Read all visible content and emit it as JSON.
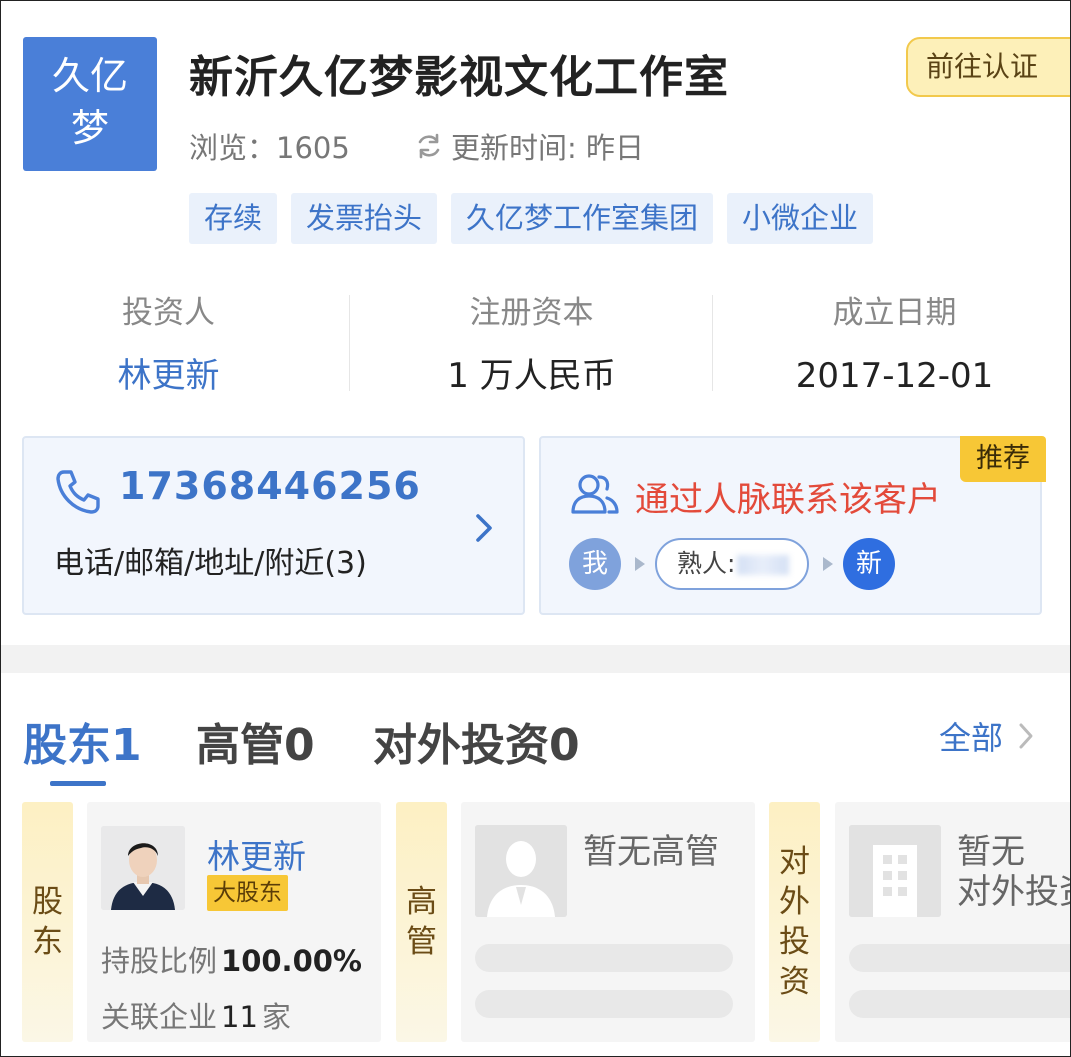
{
  "header": {
    "logo_line1": "久亿",
    "logo_line2": "梦",
    "title": "新沂久亿梦影视文化工作室",
    "verify_button": "前往认证",
    "views_label": "浏览：",
    "views_count": "1605",
    "update_label": "更新时间: 昨日",
    "tags": [
      "存续",
      "发票抬头",
      "久亿梦工作室集团",
      "小微企业"
    ]
  },
  "stats": {
    "investor_label": "投资人",
    "investor_value": "林更新",
    "capital_label": "注册资本",
    "capital_value": "1 万人民币",
    "founded_label": "成立日期",
    "founded_value": "2017-12-01"
  },
  "contact": {
    "phone": "17368446256",
    "sub": "电话/邮箱/地址/附近(3)"
  },
  "network": {
    "badge": "推荐",
    "title": "通过人脉联系该客户",
    "me": "我",
    "acquaintance": "熟人:",
    "new": "新"
  },
  "tabs": {
    "shareholders": "股东1",
    "executives": "高管0",
    "investments": "对外投资0",
    "all": "全部"
  },
  "panels": {
    "shareholder_side": "股东",
    "holder_name": "林更新",
    "holder_badge": "大股东",
    "ratio_label": "持股比例",
    "ratio_value": "100.00%",
    "related_label": "关联企业",
    "related_count": "11",
    "related_unit": "家",
    "exec_side": "高管",
    "exec_empty": "暂无高管",
    "invest_side": "对外投资",
    "invest_empty_line1": "暂无",
    "invest_empty_line2": "对外投资"
  },
  "colors": {
    "brand_blue": "#3d74c8",
    "logo_blue": "#4a7fd8",
    "accent_red": "#e34a3a",
    "badge_yellow": "#f7c736"
  }
}
